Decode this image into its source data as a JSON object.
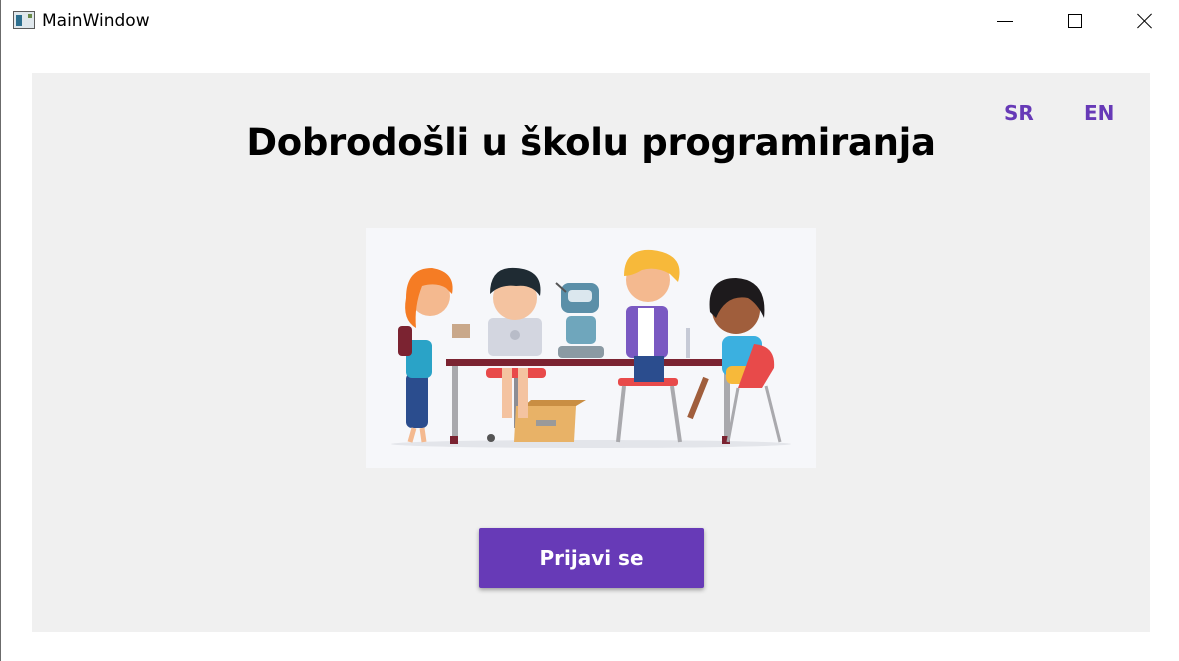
{
  "window": {
    "title": "MainWindow"
  },
  "header": {
    "lang_sr": "SR",
    "lang_en": "EN",
    "title": "Dobrodošli u školu programiranja"
  },
  "main": {
    "login_label": "Prijavi se"
  },
  "colors": {
    "accent": "#673ab7",
    "content_bg": "#f0f0f0"
  },
  "icons": {
    "app": "app-window-icon",
    "minimize": "minimize-icon",
    "maximize": "maximize-icon",
    "close": "close-icon"
  }
}
